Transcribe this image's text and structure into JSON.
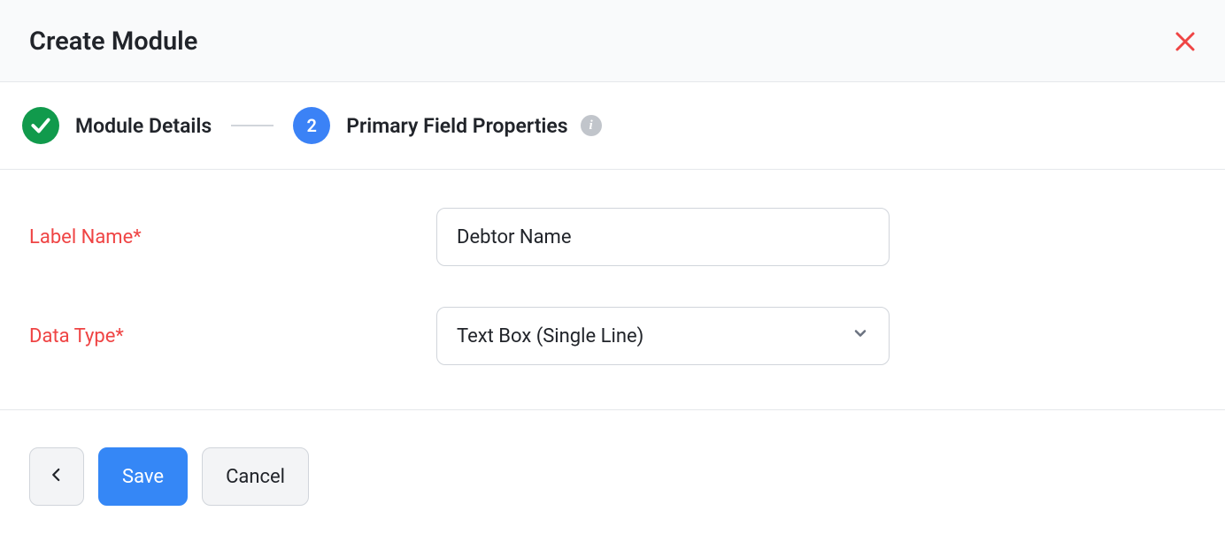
{
  "header": {
    "title": "Create Module"
  },
  "stepper": {
    "step1": {
      "label": "Module Details"
    },
    "step2": {
      "number": "2",
      "label": "Primary Field Properties"
    }
  },
  "form": {
    "labelName": {
      "label": "Label Name*",
      "value": "Debtor Name"
    },
    "dataType": {
      "label": "Data Type*",
      "value": "Text Box (Single Line)"
    }
  },
  "footer": {
    "save": "Save",
    "cancel": "Cancel"
  }
}
